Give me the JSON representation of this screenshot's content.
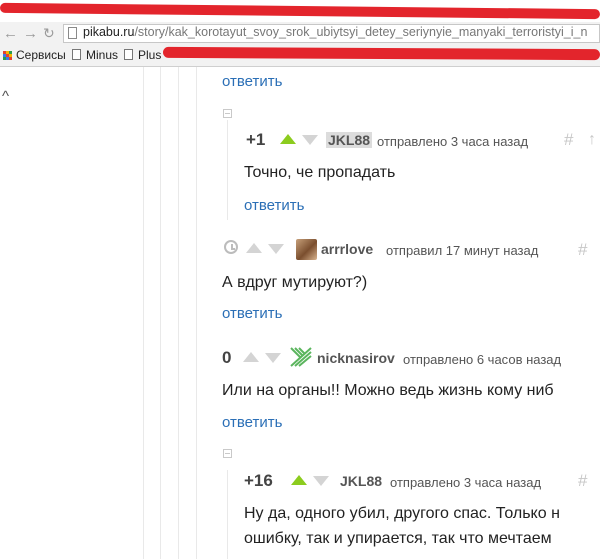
{
  "browser": {
    "url_host": "pikabu.ru",
    "url_path": "/story/kak_korotayut_svoy_srok_ubiytsyi_detey_seriynyie_manyaki_terroristyi_i_n",
    "bookmarks": [
      "Сервисы",
      "Minus",
      "Plus"
    ]
  },
  "comments": [
    {
      "reply_label": "ответить"
    },
    {
      "rating": "+1",
      "author": "JKL88",
      "meta": "отправлено 3 часа назад",
      "text": "Точно, че пропадать",
      "reply_label": "ответить"
    },
    {
      "author": "arrrlove",
      "meta": "отправил 17 минут назад",
      "text": "А вдруг мутируют?)",
      "reply_label": "ответить"
    },
    {
      "rating": "0",
      "author": "nicknasirov",
      "meta": "отправлено 6 часов назад",
      "text": "Или на органы!! Можно ведь жизнь кому ниб",
      "reply_label": "ответить"
    },
    {
      "rating": "+16",
      "author": "JKL88",
      "meta": "отправлено 3 часа назад",
      "text_line1": "Ну да, одного убил, другого спас. Только н",
      "text_line2": "ошибку, так и упирается, так что мечтаем"
    }
  ],
  "colors": {
    "accent_green": "#8ccc1e",
    "link_blue": "#2b6fb6",
    "scribble_red": "#e3252c"
  },
  "icons": [
    "back-arrow-icon",
    "forward-arrow-icon",
    "page-icon",
    "apps-grid-icon",
    "bookmark-page-icon",
    "collapse-caret-icon",
    "collapse-box-icon",
    "vote-up-icon",
    "vote-down-icon",
    "clock-icon",
    "hash-icon"
  ]
}
